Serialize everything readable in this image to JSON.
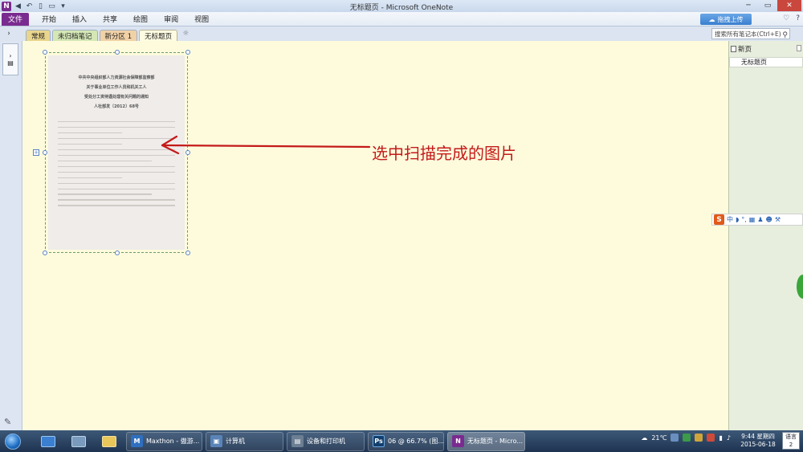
{
  "window": {
    "title": "无标题页 - Microsoft OneNote",
    "app_icon": "N"
  },
  "ribbon": {
    "file_label": "文件",
    "tabs": [
      "开始",
      "插入",
      "共享",
      "绘图",
      "审阅",
      "视图"
    ],
    "upload_label": "拖拽上传"
  },
  "sections": {
    "tabs": [
      "常规",
      "未归档笔记",
      "新分区 1",
      "无标题页"
    ],
    "search_placeholder": "搜索所有笔记本(Ctrl+E)"
  },
  "page_list": {
    "new_page_label": "新页",
    "pages": [
      "无标题页"
    ]
  },
  "annotation": {
    "text": "选中扫描完成的图片"
  },
  "scan": {
    "title_lines": [
      "中共中央组织部人力资源社会保障部监察部",
      "关于事业单位工作人员和机关工人",
      "受处分工资待遇处理有关问题的通知",
      "人社部发〔2012〕68号"
    ]
  },
  "ime": {
    "logo": "S",
    "mode": "中"
  },
  "taskbar": {
    "tasks": [
      {
        "label": "Maxthon - 傲游...",
        "icon": "M",
        "color": "#2f6fbf"
      },
      {
        "label": "计算机",
        "icon": "▣",
        "color": "#5a84b8"
      },
      {
        "label": "设备和打印机",
        "icon": "▤",
        "color": "#6c7f93"
      },
      {
        "label": "06 @ 66.7% (图...",
        "icon": "Ps",
        "color": "#123f6e"
      },
      {
        "label": "无标题页 - Micro...",
        "icon": "N",
        "color": "#7a2b8f"
      }
    ],
    "temperature": "21℃",
    "time": "9:44 星期四",
    "date": "2015-06-18",
    "ime_tray": [
      "语言",
      "2"
    ]
  },
  "colors": {
    "onenote_purple": "#7a2b8f",
    "annotation_red": "#c41a1a",
    "canvas_bg": "#fdfbdc"
  }
}
